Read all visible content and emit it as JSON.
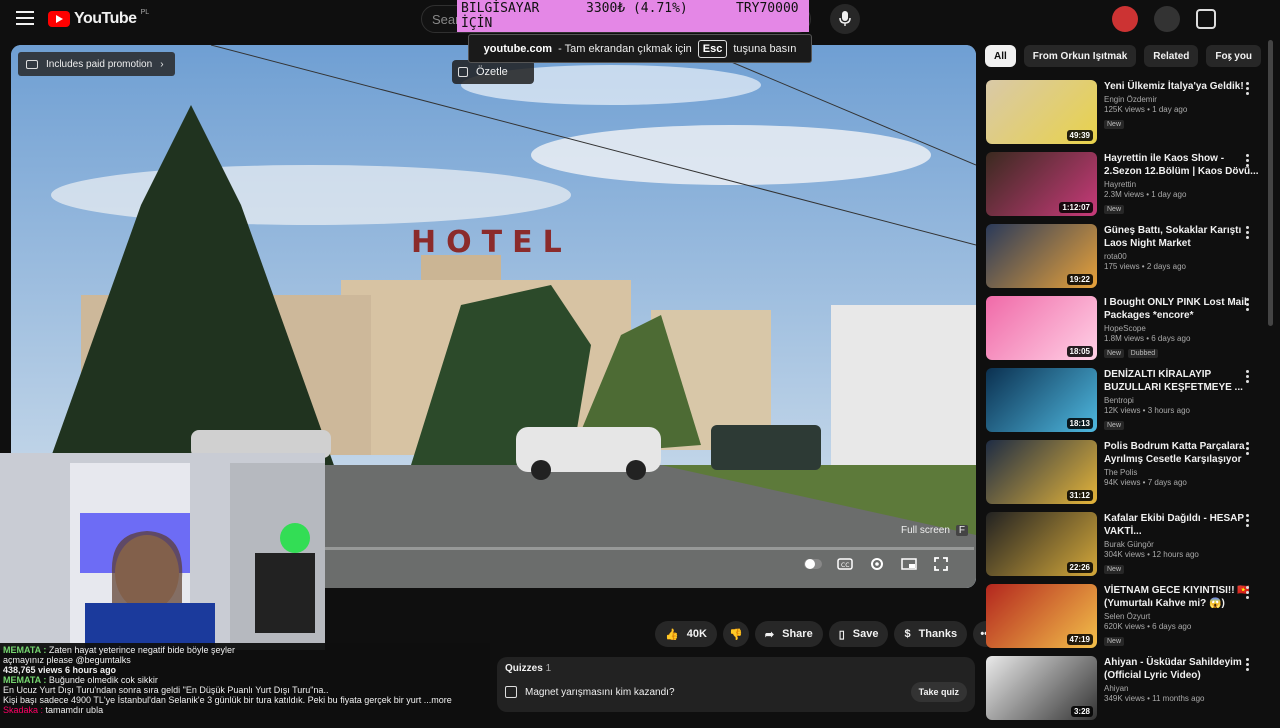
{
  "header": {
    "logo": "YouTube",
    "country": "PL",
    "search_placeholder": "Search"
  },
  "ticker": {
    "line1_left": "BILGİSAYAR",
    "line1_mid": "3300₺ (4.71%)",
    "line1_right": "TRY70000",
    "line2": "İÇİN"
  },
  "fullscreen_banner": {
    "site": "youtube.com",
    "text_before": " - Tam ekrandan çıkmak için",
    "key": "Esc",
    "text_after": "tuşuna basın"
  },
  "video": {
    "promo_label": "Includes paid promotion",
    "summarize_label": "Özetle",
    "fullscreen_tip": "Full screen",
    "fullscreen_key": "F",
    "progress": 0.005,
    "sign": "HOTEL"
  },
  "actions": {
    "likes": "40K",
    "share": "Share",
    "save": "Save",
    "thanks": "Thanks"
  },
  "chat": [
    {
      "user": "MEMATA :",
      "text": "Zaten hayat yeterince negatif bide böyle şeyler",
      "cls": "u"
    },
    {
      "user": "",
      "text": "açmayınız please @begumtalks",
      "cls": ""
    },
    {
      "user": "",
      "text": "438,765 views  6 hours ago",
      "cls": "desc-stats"
    },
    {
      "user": "MEMATA :",
      "text": "Buğunde olmedik cok sikkir",
      "cls": "u"
    },
    {
      "user": "",
      "text": "En Ucuz Yurt Dışı Turu'ndan sonra sıra geldi \"En Düşük Puanlı Yurt Dışı Turu\"na..",
      "cls": ""
    },
    {
      "user": "",
      "text": "Kişi başı sadece 4900 TL'ye İstanbul'dan Selanik'e 3 günlük bir tura katıldık. Peki bu fiyata gerçek bir yurt ...more",
      "cls": ""
    },
    {
      "user": "Skadaka :",
      "text": "tamamdır ubla",
      "cls": "u2"
    }
  ],
  "quiz": {
    "title": "Quizzes",
    "count": "1",
    "question": "Magnet yarışmasını kim kazandı?",
    "button": "Take quiz"
  },
  "chips": [
    "All",
    "From Orkun Işıtmak",
    "Related",
    "For you"
  ],
  "recommendations": [
    {
      "title": "Yeni Ülkemiz İtalya'ya Geldik!",
      "channel": "Engin Özdemir",
      "views": "125K views • 1 day ago",
      "badge": "New",
      "duration": "49:39",
      "colors": [
        "#d9c9a8",
        "#e8d24a"
      ]
    },
    {
      "title": "Hayrettin ile Kaos Show - 2.Sezon 12.Bölüm | Kaos Dövü...",
      "channel": "Hayrettin",
      "views": "2.3M views • 1 day ago",
      "badge": "New",
      "duration": "1:12:07",
      "colors": [
        "#3a2a1f",
        "#c83a7a"
      ]
    },
    {
      "title": "Güneş Battı, Sokaklar Karıştı Laos Night Market",
      "channel": "rota00",
      "views": "175 views • 2 days ago",
      "badge": "",
      "duration": "19:22",
      "colors": [
        "#2a3a5a",
        "#e8a23a"
      ]
    },
    {
      "title": "I Bought ONLY PINK Lost Mail Packages *encore*",
      "channel": "HopeScope",
      "views": "1.8M views • 6 days ago",
      "badge": "New",
      "badge2": "Dubbed",
      "duration": "18:05",
      "colors": [
        "#f06aa8",
        "#ffd1e6"
      ]
    },
    {
      "title": "DENİZALTI KİRALAYIP BUZULLARI KEŞFETMEYE ...",
      "channel": "Bentropi",
      "views": "12K views • 3 hours ago",
      "badge": "New",
      "duration": "18:13",
      "colors": [
        "#0b3050",
        "#4fb9e0"
      ]
    },
    {
      "title": "Polis Bodrum Katta Parçalara Ayrılmış Cesetle Karşılaşıyor",
      "channel": "The Polis",
      "views": "94K views • 7 days ago",
      "badge": "",
      "duration": "31:12",
      "colors": [
        "#1e2c44",
        "#e5b53a"
      ]
    },
    {
      "title": "Kafalar Ekibi Dağıldı - HESAP VAKTİ...",
      "channel": "Burak Güngör",
      "views": "304K views • 12 hours ago",
      "badge": "New",
      "duration": "22:26",
      "colors": [
        "#222",
        "#d4a83a"
      ]
    },
    {
      "title": "VİETNAM GECE KIYINTISI!! 🇻🇳 (Yumurtalı Kahve mi? 😱)",
      "channel": "Selen Özyurt",
      "views": "620K views • 6 days ago",
      "badge": "New",
      "duration": "47:19",
      "colors": [
        "#b3261e",
        "#f3c04a"
      ]
    },
    {
      "title": "Ahiyan - Üsküdar Sahildeyim (Official Lyric Video)",
      "channel": "Ahiyan",
      "views": "349K views • 11 months ago",
      "badge": "",
      "duration": "3:28",
      "colors": [
        "#eaeaea",
        "#333"
      ]
    }
  ]
}
